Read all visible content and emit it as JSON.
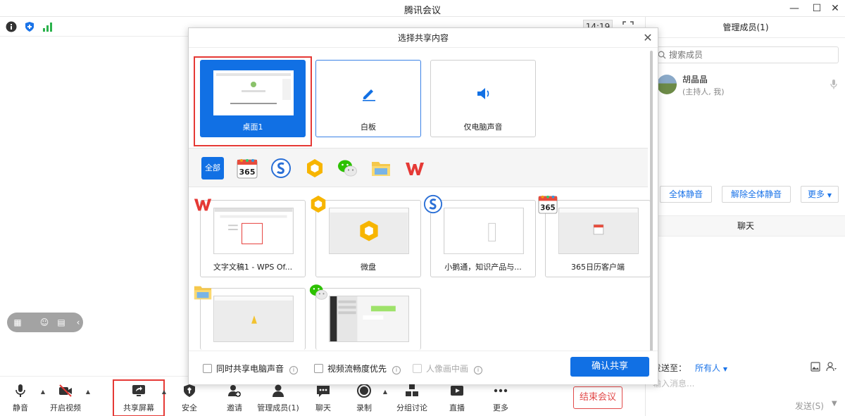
{
  "app": {
    "title": "腾讯会议"
  },
  "status": {
    "time": "14:19"
  },
  "toolbar": {
    "items": [
      {
        "label": "静音",
        "icon": "microphone-icon"
      },
      {
        "label": "开启视频",
        "icon": "video-off-icon"
      },
      {
        "label": "共享屏幕",
        "icon": "share-screen-icon"
      },
      {
        "label": "安全",
        "icon": "shield-icon"
      },
      {
        "label": "邀请",
        "icon": "add-person-icon"
      },
      {
        "label": "管理成员(1)",
        "icon": "members-icon"
      },
      {
        "label": "聊天",
        "icon": "chat-icon"
      },
      {
        "label": "录制",
        "icon": "record-icon"
      },
      {
        "label": "分组讨论",
        "icon": "breakout-icon"
      },
      {
        "label": "直播",
        "icon": "live-icon"
      },
      {
        "label": "更多",
        "icon": "more-icon"
      }
    ],
    "end_label": "结束会议"
  },
  "members_panel": {
    "title": "管理成员(1)",
    "search_placeholder": "搜索成员",
    "member": {
      "name": "胡晶晶",
      "role": "(主持人, 我)"
    },
    "mute_all": "全体静音",
    "unmute_all": "解除全体静音",
    "more": "更多"
  },
  "chat": {
    "title": "聊天",
    "send_to_label": "发送至：",
    "send_to_value": "所有人",
    "input_placeholder": "输入消息...",
    "send_label": "发送(S)"
  },
  "modal": {
    "title": "选择共享内容",
    "top_cards": [
      {
        "label": "桌面1",
        "selected": true
      },
      {
        "label": "白板"
      },
      {
        "label": "仅电脑声音"
      }
    ],
    "filter_all": "全部",
    "filter_icons": [
      "calendar-365-icon",
      "sogou-browser-icon",
      "weiyun-icon",
      "wechat-icon",
      "folder-icon",
      "wps-icon"
    ],
    "windows": [
      {
        "label": "文字文稿1 - WPS Of...",
        "badge": "wps-icon"
      },
      {
        "label": "微盘",
        "badge": "weiyun-icon"
      },
      {
        "label": "小鹅通，知识产品与...",
        "badge": "sogou-browser-icon"
      },
      {
        "label": "365日历客户端",
        "badge": "calendar-365-icon"
      },
      {
        "label": "",
        "badge": "folder-icon"
      },
      {
        "label": "",
        "badge": "wechat-icon"
      }
    ],
    "options": {
      "share_audio": "同时共享电脑声音",
      "video_smooth": "视频流畅度优先",
      "portrait": "人像画中画"
    },
    "confirm_label": "确认共享"
  },
  "colors": {
    "accent": "#1170e4",
    "danger": "#e53935"
  }
}
